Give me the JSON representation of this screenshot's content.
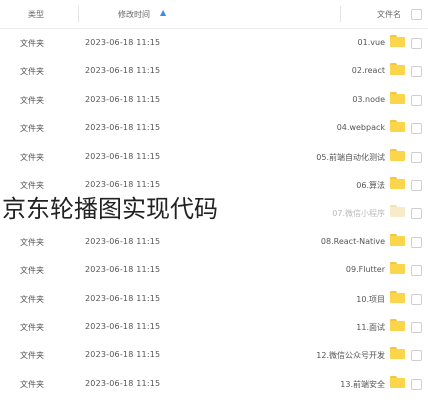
{
  "header": {
    "type_label": "类型",
    "time_label": "修改时间",
    "name_label": "文件名"
  },
  "rows": [
    {
      "type": "文件夹",
      "time": "2023-06-18 11:15",
      "name": "01.vue"
    },
    {
      "type": "文件夹",
      "time": "2023-06-18 11:15",
      "name": "02.react"
    },
    {
      "type": "文件夹",
      "time": "2023-06-18 11:15",
      "name": "03.node"
    },
    {
      "type": "文件夹",
      "time": "2023-06-18 11:15",
      "name": "04.webpack"
    },
    {
      "type": "文件夹",
      "time": "2023-06-18 11:15",
      "name": "05.前端自动化测试"
    },
    {
      "type": "文件夹",
      "time": "2023-06-18 11:15",
      "name": "06.算法"
    },
    {
      "type": "",
      "time": "",
      "name": "07.微信小程序"
    },
    {
      "type": "文件夹",
      "time": "2023-06-18 11:15",
      "name": "08.React-Native"
    },
    {
      "type": "文件夹",
      "time": "2023-06-18 11:15",
      "name": "09.Flutter"
    },
    {
      "type": "文件夹",
      "time": "2023-06-18 11:15",
      "name": "10.项目"
    },
    {
      "type": "文件夹",
      "time": "2023-06-18 11:15",
      "name": "11.面试"
    },
    {
      "type": "文件夹",
      "time": "2023-06-18 11:15",
      "name": "12.微信公众号开发"
    },
    {
      "type": "文件夹",
      "time": "2023-06-18 11:15",
      "name": "13.前端安全"
    }
  ],
  "overlay_title": "京东轮播图实现代码",
  "icons": {
    "folder": "folder-icon",
    "sort": "sort-arrow-icon",
    "checkbox": "checkbox"
  },
  "colors": {
    "folder": "#fbd54a",
    "accent": "#3a8ee6"
  }
}
